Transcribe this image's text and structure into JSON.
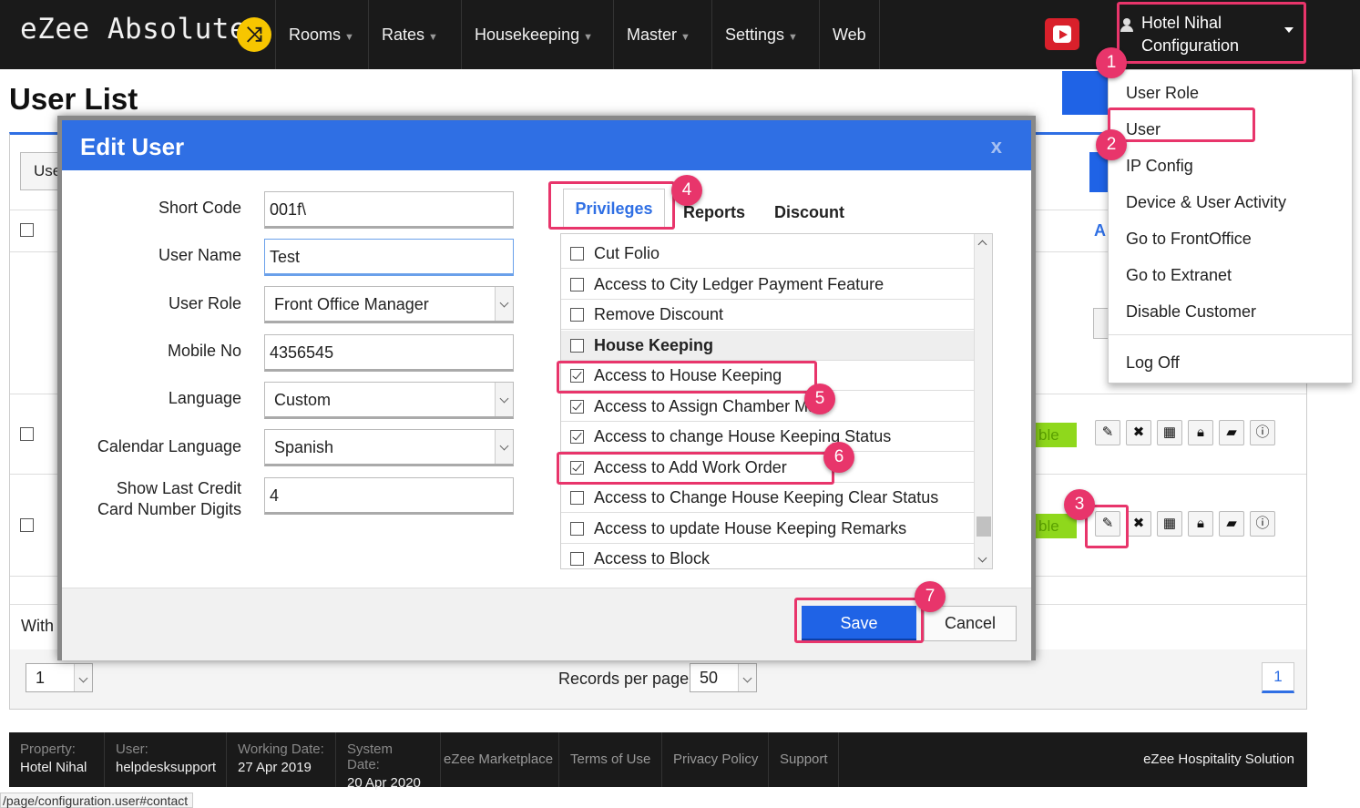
{
  "app": {
    "brand": "eZee Absolute",
    "nav": [
      "Rooms",
      "Rates",
      "Housekeeping",
      "Master",
      "Settings",
      "Web"
    ],
    "hotel_name": "Hotel Nihal",
    "hotel_section": "Configuration"
  },
  "dropdown": {
    "items": [
      "User Role",
      "User",
      "IP Config",
      "Device & User Activity",
      "Go to FrontOffice",
      "Go to Extranet",
      "Disable Customer"
    ],
    "logoff": "Log Off"
  },
  "page": {
    "title": "User List",
    "user_button_partial": "Use",
    "with_label": "With",
    "page_select": "1",
    "records_label": "Records per page",
    "records_value": "50",
    "current_page": "1",
    "badge_partial": "ble",
    "a_label": "A"
  },
  "modal": {
    "title": "Edit User",
    "close": "x",
    "fields": {
      "short_code_label": "Short Code",
      "short_code_value": "001f\\",
      "user_name_label": "User Name",
      "user_name_value": "Test",
      "user_role_label": "User Role",
      "user_role_value": "Front Office Manager",
      "mobile_label": "Mobile No",
      "mobile_value": "4356545",
      "language_label": "Language",
      "language_value": "Custom",
      "calendar_label": "Calendar Language",
      "calendar_value": "Spanish",
      "last_digits_label_1": "Show Last Credit",
      "last_digits_label_2": "Card Number Digits",
      "last_digits_value": "4"
    },
    "tabs": [
      "Privileges",
      "Reports",
      "Discount"
    ],
    "privileges": [
      {
        "label": "Cut Folio",
        "checked": false,
        "header": false
      },
      {
        "label": "Access to City Ledger Payment Feature",
        "checked": false,
        "header": false
      },
      {
        "label": "Remove Discount",
        "checked": false,
        "header": false
      },
      {
        "label": "House Keeping",
        "checked": false,
        "header": true
      },
      {
        "label": "Access to House Keeping",
        "checked": true,
        "header": false
      },
      {
        "label": "Access to Assign Chamber Maid",
        "checked": true,
        "header": false
      },
      {
        "label": "Access to change House Keeping Status",
        "checked": true,
        "header": false
      },
      {
        "label": "Access to Add Work Order",
        "checked": true,
        "header": false
      },
      {
        "label": "Access to Change House Keeping Clear Status",
        "checked": false,
        "header": false
      },
      {
        "label": "Access to update House Keeping Remarks",
        "checked": false,
        "header": false
      },
      {
        "label": "Access to Block",
        "checked": false,
        "header": false
      }
    ],
    "save": "Save",
    "cancel": "Cancel"
  },
  "steps": [
    "1",
    "2",
    "3",
    "4",
    "5",
    "6",
    "7"
  ],
  "statusbar": {
    "property_label": "Property:",
    "property_value": "Hotel Nihal",
    "user_label": "User:",
    "user_value": "helpdesksupport",
    "working_label": "Working Date:",
    "working_value": "27 Apr 2019",
    "system_label": "System Date:",
    "system_value": "20 Apr 2020",
    "links": [
      "eZee Marketplace",
      "Terms of Use",
      "Privacy Policy",
      "Support"
    ],
    "brand": "eZee Hospitality Solution"
  },
  "url_hint": "/page/configuration.user#contact",
  "colors": {
    "accent": "#2f6fe4",
    "annotation": "#e8356b",
    "nav_bg": "#1a1a1a",
    "badge": "#8fd81c"
  },
  "icons": [
    "shuffle-icon",
    "youtube-icon",
    "user-icon",
    "edit-icon",
    "delete-icon",
    "calculator-icon",
    "lock-icon",
    "comment-icon",
    "info-icon"
  ]
}
